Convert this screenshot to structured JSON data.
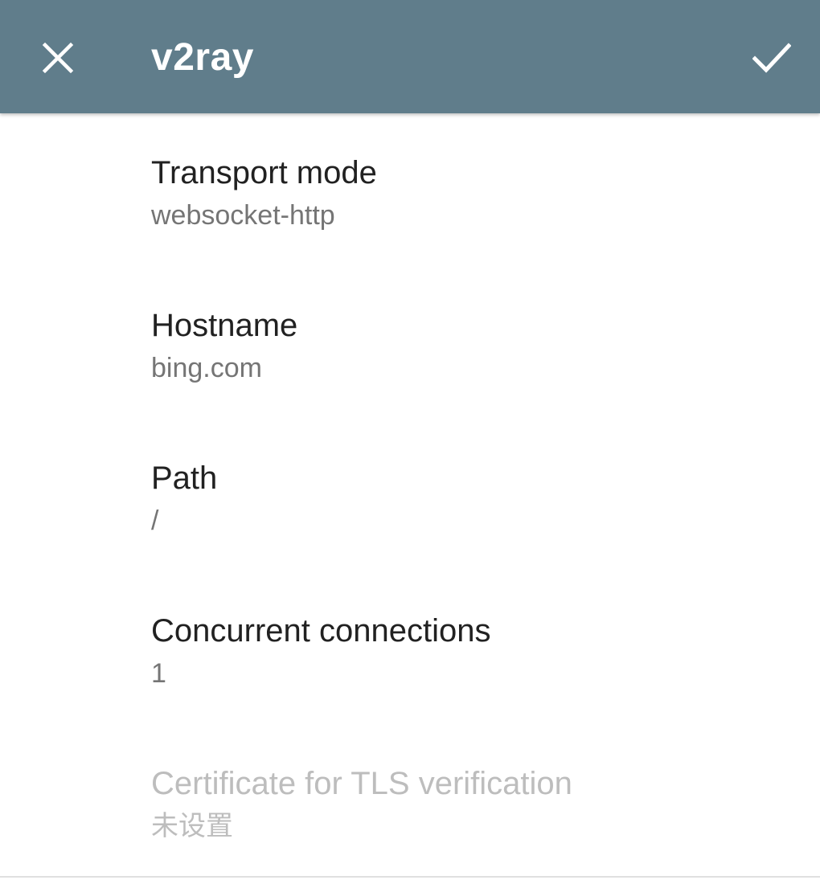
{
  "toolbar": {
    "title": "v2ray",
    "close_icon": "close-icon",
    "confirm_icon": "check-icon",
    "background_color": "#607d8b"
  },
  "preferences": [
    {
      "title": "Transport mode",
      "summary": "websocket-http",
      "enabled": true
    },
    {
      "title": "Hostname",
      "summary": "bing.com",
      "enabled": true
    },
    {
      "title": "Path",
      "summary": "/",
      "enabled": true
    },
    {
      "title": "Concurrent connections",
      "summary": "1",
      "enabled": true
    },
    {
      "title": "Certificate for TLS verification",
      "summary": "未设置",
      "enabled": false
    }
  ]
}
